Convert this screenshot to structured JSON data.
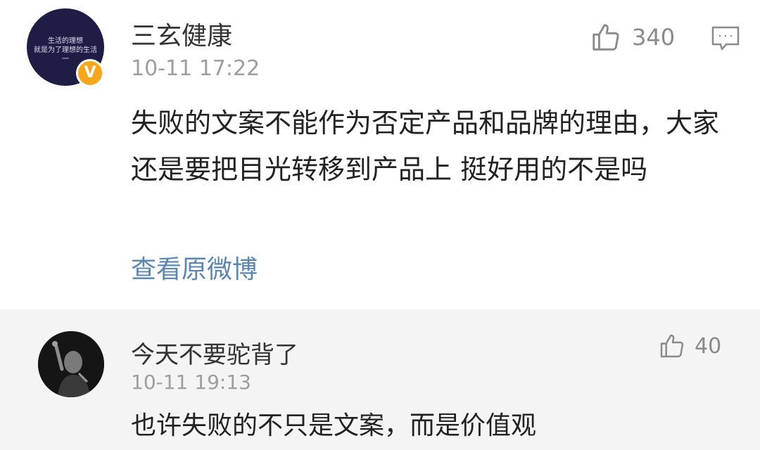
{
  "main_comment": {
    "author": "三玄健康",
    "verified_badge": "V",
    "avatar_text": [
      "生活的理想",
      "就是为了理想的生活",
      "一"
    ],
    "timestamp": "10-11 17:22",
    "likes": "340",
    "text": "失败的文案不能作为否定产品和品牌的理由，大家还是要把目光转移到产品上 挺好用的不是吗",
    "view_original_label": "查看原微博"
  },
  "reply": {
    "author": "今天不要驼背了",
    "timestamp": "10-11 19:13",
    "likes": "40",
    "text": "也许失败的不只是文案，而是价值观"
  },
  "colors": {
    "link": "#5a86b0",
    "badge": "#f7a51a",
    "muted": "#9e9e9e",
    "reply_background": "#f4f4f4"
  },
  "icons": [
    "thumbs-up-icon",
    "comment-reply-icon",
    "verified-v-icon"
  ]
}
